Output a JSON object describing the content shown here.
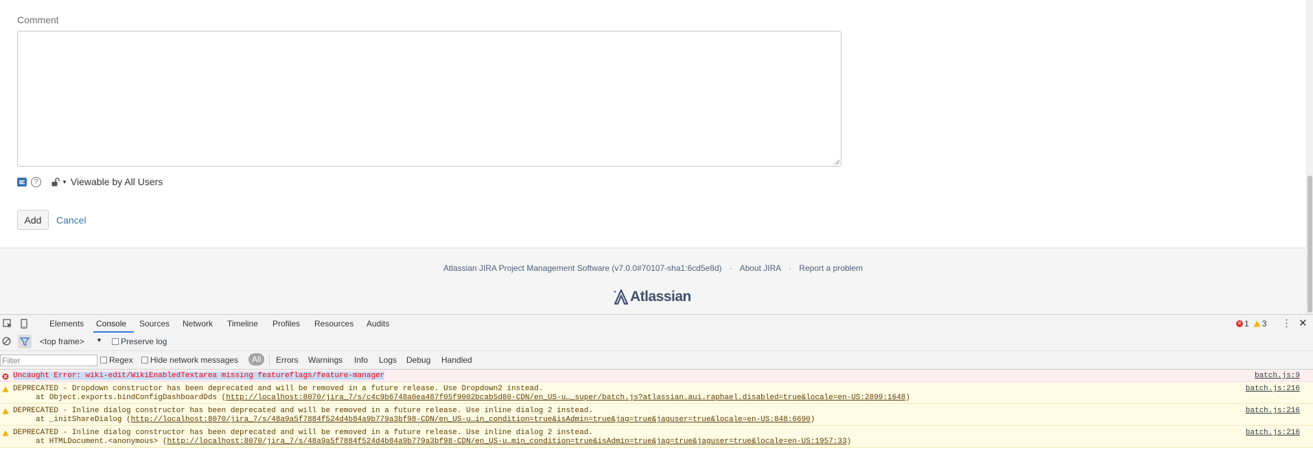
{
  "form": {
    "comment_label": "Comment",
    "comment_value": "",
    "visibility_label": "Viewable by All Users",
    "add_label": "Add",
    "cancel_label": "Cancel"
  },
  "footer": {
    "version_text": "Atlassian JIRA Project Management Software (v7.0.0#70107-sha1:6cd5e8d)",
    "about_label": "About JIRA",
    "report_label": "Report a problem",
    "separator": "·",
    "logo_text": "Atlassian"
  },
  "devtools": {
    "tabs": [
      "Elements",
      "Console",
      "Sources",
      "Network",
      "Timeline",
      "Profiles",
      "Resources",
      "Audits"
    ],
    "active_tab": "Console",
    "error_count": "1",
    "warning_count": "3",
    "frame": "<top frame>",
    "preserve_log_label": "Preserve log",
    "filter_placeholder": "Filter",
    "regex_label": "Regex",
    "hide_network_label": "Hide network messages",
    "levels": [
      "All",
      "Errors",
      "Warnings",
      "Info",
      "Logs",
      "Debug",
      "Handled"
    ],
    "messages": [
      {
        "level": "error",
        "text": "Uncaught Error: wiki-edit/WikiEnabledTextarea missing featureflags/feature-manager",
        "source": "batch.js:9"
      },
      {
        "level": "warning",
        "text": "DEPRECATED - Dropdown constructor has been deprecated and will be removed in a future release. Use Dropdown2 instead.",
        "trace_prefix": "at Object.exports.bindConfigDashboardDds (",
        "trace_link": "http://localhost:8070/jira_7/s/c4c9b6748a0ea487f05f9002bcab5d80-CDN/en_US-u…_super/batch.js?atlassian.aui.raphael.disabled=true&locale=en-US:2899:1648",
        "trace_suffix": ")",
        "source": "batch.js:216"
      },
      {
        "level": "warning",
        "text": "DEPRECATED - Inline dialog constructor has been deprecated and will be removed in a future release. Use inline dialog 2 instead.",
        "trace_prefix": "at _initShareDialog (",
        "trace_link": "http://localhost:8070/jira_7/s/48a9a5f7884f524d4b84a9b779a3bf98-CDN/en_US-u…in_condition=true&isAdmin=true&jag=true&jaguser=true&locale=en-US:848:6690",
        "trace_suffix": ")",
        "source": "batch.js:216"
      },
      {
        "level": "warning",
        "text": "DEPRECATED - Inline dialog constructor has been deprecated and will be removed in a future release. Use inline dialog 2 instead.",
        "trace_prefix": "at HTMLDocument.<anonymous> (",
        "trace_link": "http://localhost:8070/jira_7/s/48a9a5f7884f524d4b84a9b779a3bf98-CDN/en_US-u…min_condition=true&isAdmin=true&jag=true&jaguser=true&locale=en-US:1957:33",
        "trace_suffix": ")",
        "source": "batch.js:216"
      }
    ]
  },
  "colors": {
    "link": "#3b73af",
    "error": "#ff0000",
    "warning_bg": "#fffbe5",
    "error_bg": "#fff0f0",
    "selection": "#c9dbf7",
    "active_tab_underline": "#3879d9"
  }
}
